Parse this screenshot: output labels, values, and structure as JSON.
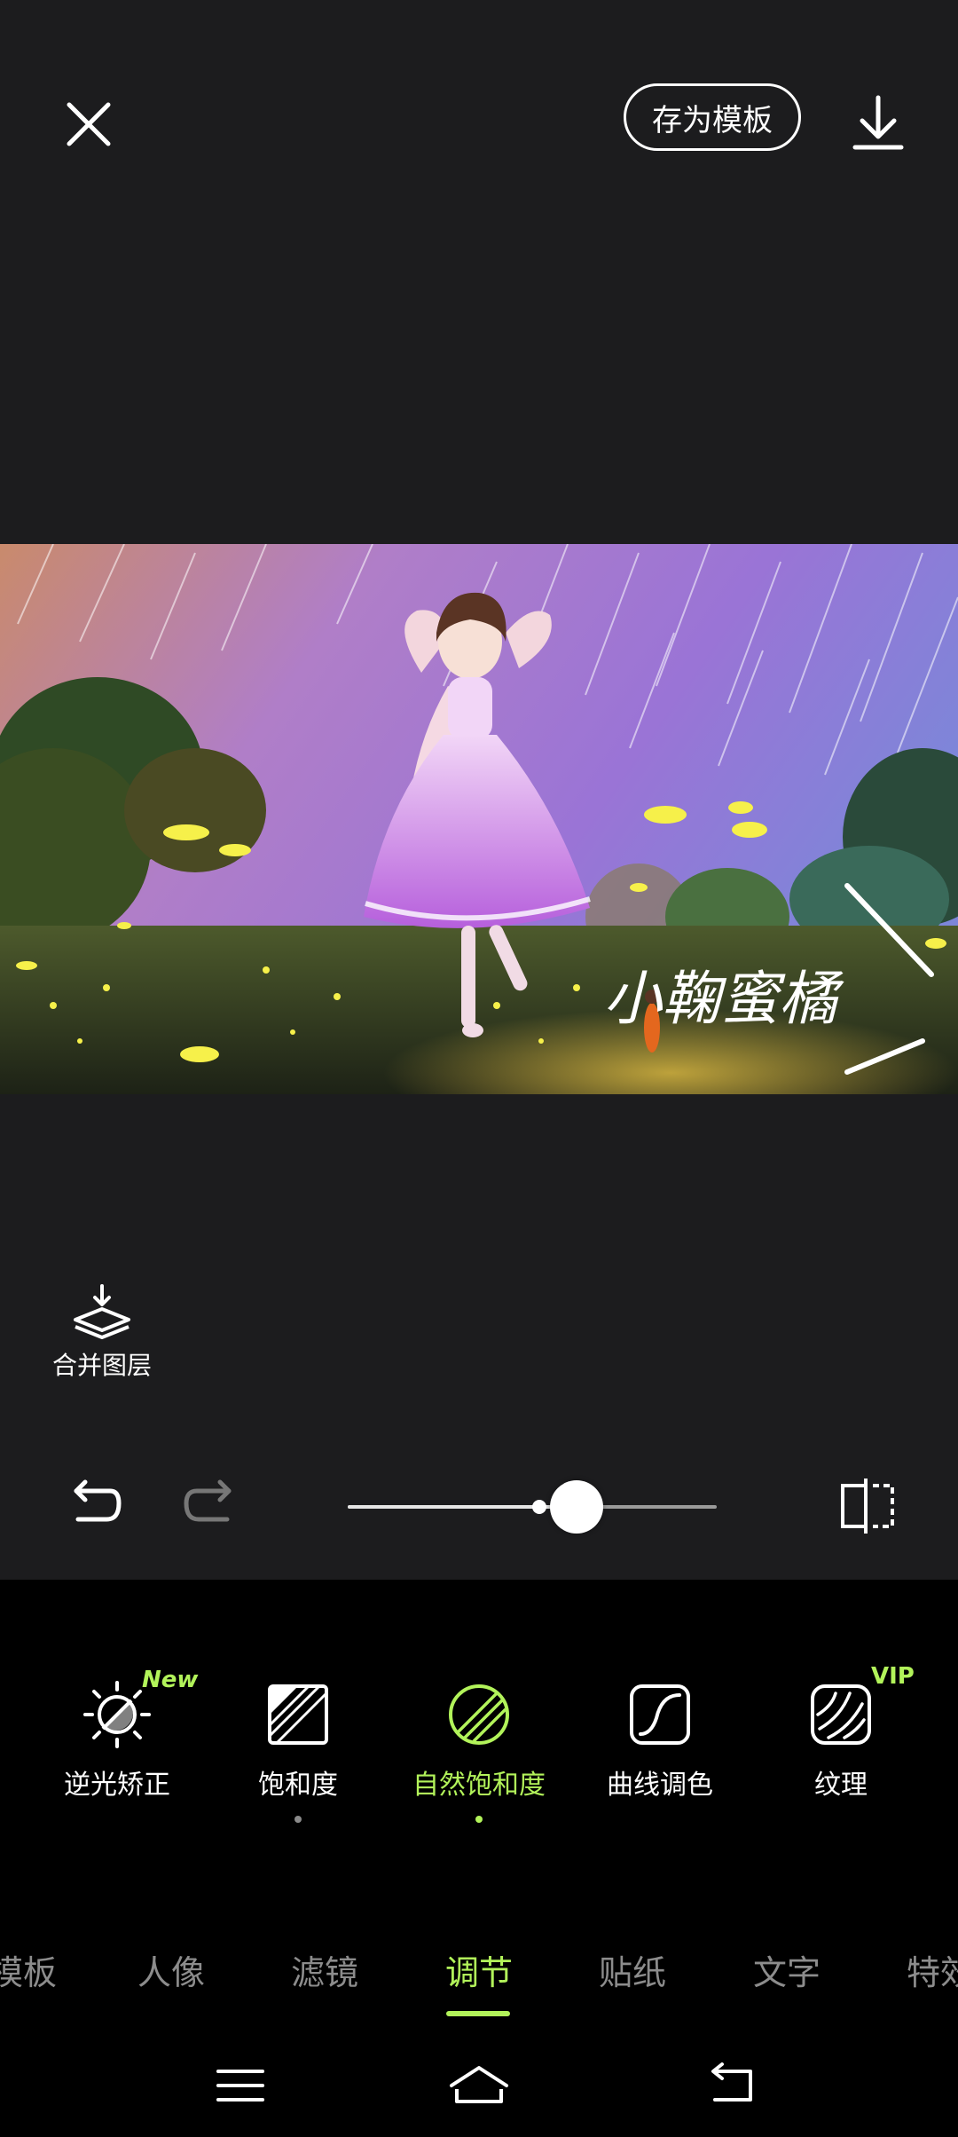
{
  "header": {
    "save_template_label": "存为模板",
    "close_icon": "close-icon",
    "download_icon": "download-icon"
  },
  "canvas": {
    "signature_text": "小鞠蜜橘"
  },
  "merge_layers": {
    "label": "合并图层",
    "icon": "merge-layers-icon"
  },
  "controls": {
    "undo_icon": "undo-icon",
    "redo_icon": "redo-icon",
    "slider_value": 0.62,
    "compare_icon": "compare-icon"
  },
  "tools": [
    {
      "label": "逆光矫正",
      "badge": "New",
      "icon": "backlight-icon"
    },
    {
      "label": "饱和度",
      "icon": "saturation-icon",
      "dot": true
    },
    {
      "label": "自然饱和度",
      "icon": "vibrance-icon",
      "dot": true,
      "active": true
    },
    {
      "label": "曲线调色",
      "icon": "curves-icon"
    },
    {
      "label": "纹理",
      "badge": "VIP",
      "icon": "texture-icon"
    }
  ],
  "tabs": [
    "模板",
    "人像",
    "滤镜",
    "调节",
    "贴纸",
    "文字",
    "特效"
  ],
  "active_tab": "调节",
  "nav": {
    "menu_icon": "menu-icon",
    "home_icon": "home-icon",
    "back_icon": "back-icon"
  },
  "colors": {
    "accent": "#b2f35a",
    "background": "#1c1c1e",
    "panel": "#000000"
  }
}
